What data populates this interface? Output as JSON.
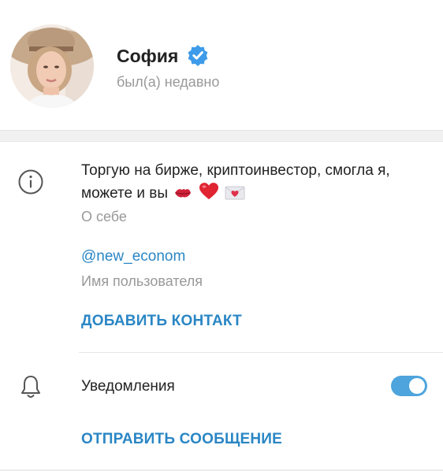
{
  "profile": {
    "name": "София",
    "status": "был(а) недавно",
    "verified": true
  },
  "info": {
    "bio_line1": "Торгую на бирже, криптоинвестор, смогла я,",
    "bio_line2": "можете и вы",
    "bio_label": "О себе",
    "username": "@new_econom",
    "username_label": "Имя пользователя"
  },
  "actions": {
    "add_contact": "ДОБАВИТЬ КОНТАКТ",
    "send_message": "ОТПРАВИТЬ СООБЩЕНИЕ"
  },
  "notifications": {
    "label": "Уведомления",
    "enabled": true
  },
  "colors": {
    "accent": "#2a86c4",
    "toggle_on": "#4ea4dc",
    "verified_badge": "#3d9be9"
  }
}
